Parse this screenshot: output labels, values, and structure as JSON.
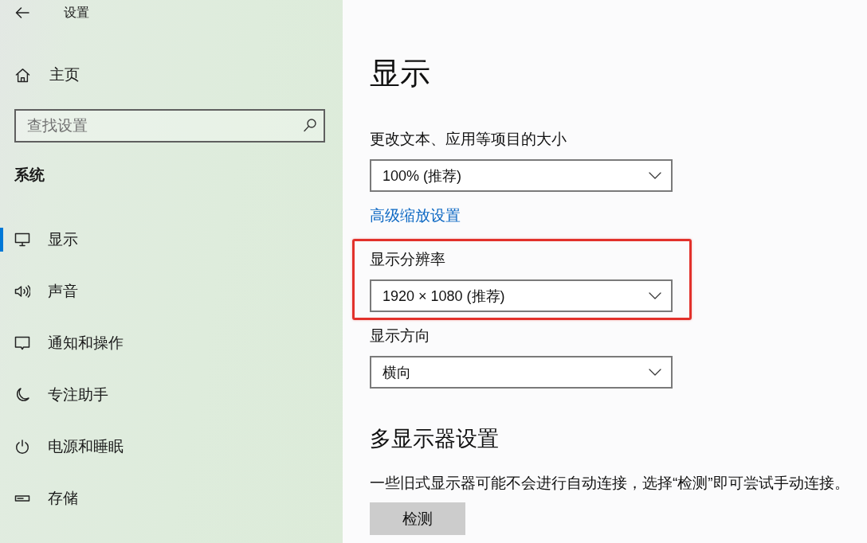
{
  "window": {
    "title": "设置"
  },
  "sidebar": {
    "home": "主页",
    "search": {
      "placeholder": "查找设置"
    },
    "section": "系统",
    "items": [
      {
        "label": "显示",
        "selected": true
      },
      {
        "label": "声音",
        "selected": false
      },
      {
        "label": "通知和操作",
        "selected": false
      },
      {
        "label": "专注助手",
        "selected": false
      },
      {
        "label": "电源和睡眠",
        "selected": false
      },
      {
        "label": "存储",
        "selected": false
      }
    ]
  },
  "content": {
    "title": "显示",
    "settings": [
      {
        "kind": "dropdown",
        "label": "更改文本、应用等项目的大小",
        "value": "100% (推荐)",
        "highlighted": false
      },
      {
        "kind": "link",
        "label": "高级缩放设置"
      },
      {
        "kind": "dropdown",
        "label": "显示分辨率",
        "value": "1920 × 1080 (推荐)",
        "highlighted": true
      },
      {
        "kind": "dropdown",
        "label": "显示方向",
        "value": "横向",
        "highlighted": false
      }
    ],
    "multiple_displays": {
      "heading": "多显示器设置",
      "description": "一些旧式显示器可能不会进行自动连接，选择“检测”即可尝试手动连接。",
      "button": "检测"
    }
  }
}
